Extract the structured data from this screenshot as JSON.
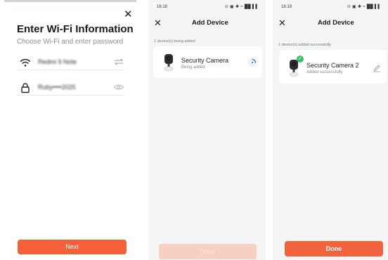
{
  "wifi_screen": {
    "title": "Enter Wi-Fi Information",
    "subtitle": "Choose Wi-Fi and enter password",
    "network_value": "Redmi 9 Note",
    "password_value": "Ruby••••2025",
    "next_label": "Next"
  },
  "adding_screen": {
    "status_bar": {
      "time": "16:18",
      "icons": "⊙ ▣ ✱ ≈ ██ ▌▌"
    },
    "title": "Add Device",
    "section_label": "1 device(s) being added",
    "device": {
      "name": "Security Camera",
      "status": "Being added"
    },
    "button_label": "Done"
  },
  "success_screen": {
    "status_bar": {
      "time": "16:19",
      "icons": "⊙ ▣ ✱ ≈ ██ ▌▌"
    },
    "title": "Add Device",
    "section_label": "1 device(s) added successfully",
    "device": {
      "name": "Security Camera 2",
      "status": "Added successfully"
    },
    "button_label": "Done"
  },
  "icons": {
    "close": "✕",
    "check": "✓"
  },
  "colors": {
    "accent": "#f55f3a",
    "accent_disabled": "#f7cfc3",
    "success": "#3bbf6a",
    "screen_bg": "#f4f5f7"
  }
}
